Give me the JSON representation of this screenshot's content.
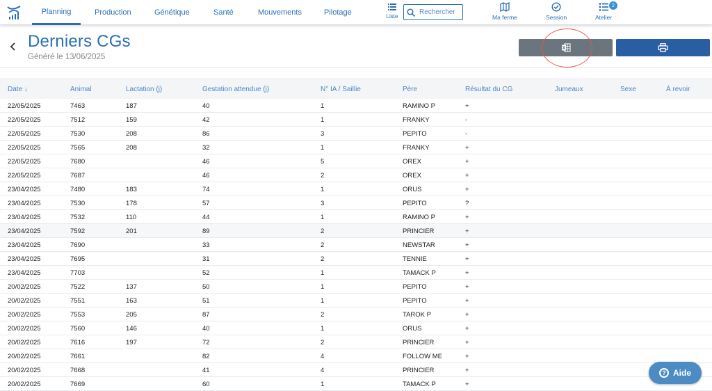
{
  "nav": {
    "tabs": [
      {
        "label": "Planning",
        "active": true
      },
      {
        "label": "Production"
      },
      {
        "label": "Génétique"
      },
      {
        "label": "Santé"
      },
      {
        "label": "Mouvements"
      },
      {
        "label": "Pilotage"
      }
    ],
    "liste_label": "Liste",
    "search_placeholder": "Rechercher",
    "ma_ferme_label": "Ma ferme",
    "session_label": "Session",
    "atelier_label": "Atelier",
    "atelier_badge": "2"
  },
  "header": {
    "title": "Derniers CGs",
    "subtitle": "Généré le 13/06/2025"
  },
  "colors": {
    "primary": "#2a6fb3",
    "excel_button": "#6a757d",
    "print_button": "#2a5ea3",
    "annotation": "#e05a4a"
  },
  "table": {
    "columns": [
      "Date ↓",
      "Animal",
      "Lactation (j)",
      "Gestation attendue (j)",
      "N° IA / Saillie",
      "Père",
      "Résultat du CG",
      "Jumeaux",
      "Sexe",
      "À revoir"
    ],
    "rows": [
      [
        "22/05/2025",
        "7463",
        "187",
        "40",
        "1",
        "RAMINO P",
        "+"
      ],
      [
        "22/05/2025",
        "7512",
        "159",
        "42",
        "1",
        "FRANKY",
        "-"
      ],
      [
        "22/05/2025",
        "7530",
        "208",
        "86",
        "3",
        "PEPITO",
        "-"
      ],
      [
        "22/05/2025",
        "7565",
        "208",
        "32",
        "1",
        "FRANKY",
        "+"
      ],
      [
        "22/05/2025",
        "7680",
        "",
        "46",
        "5",
        "OREX",
        "+"
      ],
      [
        "22/05/2025",
        "7687",
        "",
        "46",
        "2",
        "OREX",
        "+"
      ],
      [
        "23/04/2025",
        "7480",
        "183",
        "74",
        "1",
        "ORUS",
        "+"
      ],
      [
        "23/04/2025",
        "7530",
        "178",
        "57",
        "3",
        "PEPITO",
        "?"
      ],
      [
        "23/04/2025",
        "7532",
        "110",
        "44",
        "1",
        "RAMINO P",
        "+"
      ],
      [
        "23/04/2025",
        "7592",
        "201",
        "89",
        "2",
        "PRINCIER",
        "+"
      ],
      [
        "23/04/2025",
        "7690",
        "",
        "33",
        "2",
        "NEWSTAR",
        "+"
      ],
      [
        "23/04/2025",
        "7695",
        "",
        "31",
        "2",
        "TENNIE",
        "+"
      ],
      [
        "23/04/2025",
        "7703",
        "",
        "52",
        "1",
        "TAMACK P",
        "+"
      ],
      [
        "20/02/2025",
        "7522",
        "137",
        "50",
        "1",
        "PEPITO",
        "+"
      ],
      [
        "20/02/2025",
        "7551",
        "163",
        "51",
        "1",
        "PEPITO",
        "+"
      ],
      [
        "20/02/2025",
        "7553",
        "205",
        "87",
        "2",
        "TAROK P",
        "+"
      ],
      [
        "20/02/2025",
        "7560",
        "146",
        "40",
        "1",
        "ORUS",
        "+"
      ],
      [
        "20/02/2025",
        "7616",
        "197",
        "72",
        "2",
        "PRINCIER",
        "+"
      ],
      [
        "20/02/2025",
        "7661",
        "",
        "82",
        "4",
        "FOLLOW ME",
        "+"
      ],
      [
        "20/02/2025",
        "7668",
        "",
        "41",
        "4",
        "PRINCIER",
        "+"
      ],
      [
        "20/02/2025",
        "7669",
        "",
        "60",
        "1",
        "TAMACK P",
        "+"
      ]
    ]
  },
  "help": {
    "label": "Aide",
    "icon": "question-icon"
  }
}
